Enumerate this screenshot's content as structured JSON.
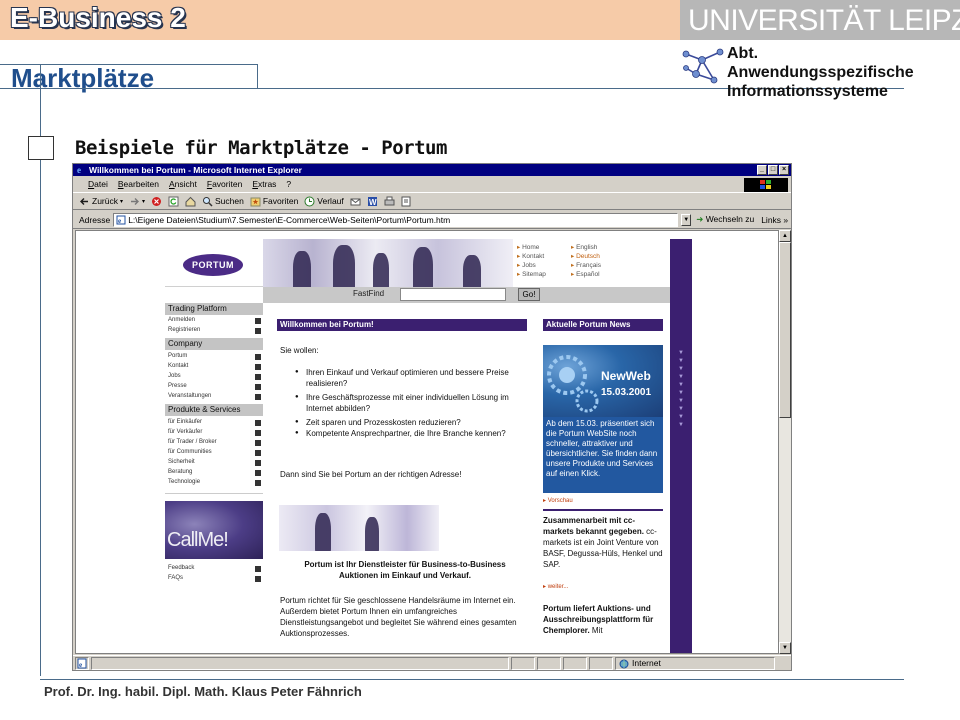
{
  "slide": {
    "course_title": "E-Business 2",
    "university": "UNIVERSITÄT LEIPZIG",
    "dept_lines": [
      "Abt.",
      "Anwendungsspezifische",
      "Informationssysteme"
    ],
    "section_title": "Marktplätze",
    "heading": "Beispiele für Marktplätze - Portum",
    "footer": "Prof. Dr. Ing. habil. Dipl. Math. Klaus Peter Fähnrich"
  },
  "browser": {
    "title": "Willkommen bei Portum - Microsoft Internet Explorer",
    "menu": [
      "Datei",
      "Bearbeiten",
      "Ansicht",
      "Favoriten",
      "Extras",
      "?"
    ],
    "toolbar": {
      "back": "Zurück",
      "search": "Suchen",
      "favorites": "Favoriten",
      "history": "Verlauf"
    },
    "address": {
      "label": "Adresse",
      "value": "L:\\Eigene Dateien\\Studium\\7.Semester\\E-Commerce\\Web-Seiten\\Portum\\Portum.htm",
      "go": "Wechseln zu",
      "links": "Links"
    },
    "status": {
      "zone": "Internet"
    }
  },
  "portum": {
    "logo": "PORTUM",
    "nav": [
      "Home",
      "Kontakt",
      "Jobs",
      "Sitemap"
    ],
    "languages": [
      "English",
      "Deutsch",
      "Français",
      "Español"
    ],
    "fastfind": {
      "label": "FastFind",
      "button": "Go!"
    },
    "sidebar": {
      "trading": {
        "title": "Trading Platform",
        "links": [
          "Anmelden",
          "Registrieren"
        ]
      },
      "company": {
        "title": "Company",
        "links": [
          "Portum",
          "Kontakt",
          "Jobs",
          "Presse",
          "Veranstaltungen"
        ]
      },
      "products": {
        "title": "Produkte & Services",
        "links": [
          "für Einkäufer",
          "für Verkäufer",
          "für Trader / Broker",
          "für Communities",
          "Sicherheit",
          "Beratung",
          "Technologie"
        ]
      },
      "callme": "CallMe!",
      "bottom_links": [
        "Feedback",
        "FAQs"
      ]
    },
    "welcome": {
      "title": "Willkommen bei Portum!",
      "intro": "Sie wollen:",
      "bullets": [
        "Ihren Einkauf und Verkauf optimieren und bessere Preise realisieren?",
        "Ihre Geschäftsprozesse mit einer individuellen Lösung im Internet abbilden?",
        "Zeit sparen und Prozesskosten reduzieren?",
        "Kompetente Ansprechpartner, die Ihre Branche kennen?"
      ],
      "closing": "Dann sind Sie bei Portum an der richtigen Adresse!",
      "tagline": "Portum ist Ihr Dienstleister für Business-to-Business Auktionen im Einkauf und Verkauf.",
      "body": "Portum richtet für Sie geschlossene Handelsräume im Internet ein. Außerdem bietet Portum Ihnen ein umfangreiches Dienstleistungsangebot und begleitet Sie während eines gesamten Auktionsprozesses."
    },
    "news": {
      "title": "Aktuelle Portum News",
      "image_title": "NewWeb",
      "image_date": "15.03.2001",
      "item1": "Ab dem 15.03. präsentiert sich die Portum WebSite noch schneller, attraktiver und übersichtlicher. Sie finden dann unsere Produkte und Services auf einen Klick.",
      "item1_more": "Vorschau",
      "item2_head": "Zusammenarbeit mit cc-markets bekannt gegeben.",
      "item2_body": "cc-markets ist ein Joint Venture von BASF, Degussa-Hüls, Henkel und SAP.",
      "item2_more": "weiter...",
      "item3_head": "Portum liefert Auktions- und Ausschreibungsplattform für Chemplorer.",
      "item3_body": "Mit"
    }
  },
  "colors": {
    "header_band": "#f6cba8",
    "accent_blue": "#1f4e8c",
    "portum_purple": "#3b1f70",
    "ie_title": "#000080"
  }
}
